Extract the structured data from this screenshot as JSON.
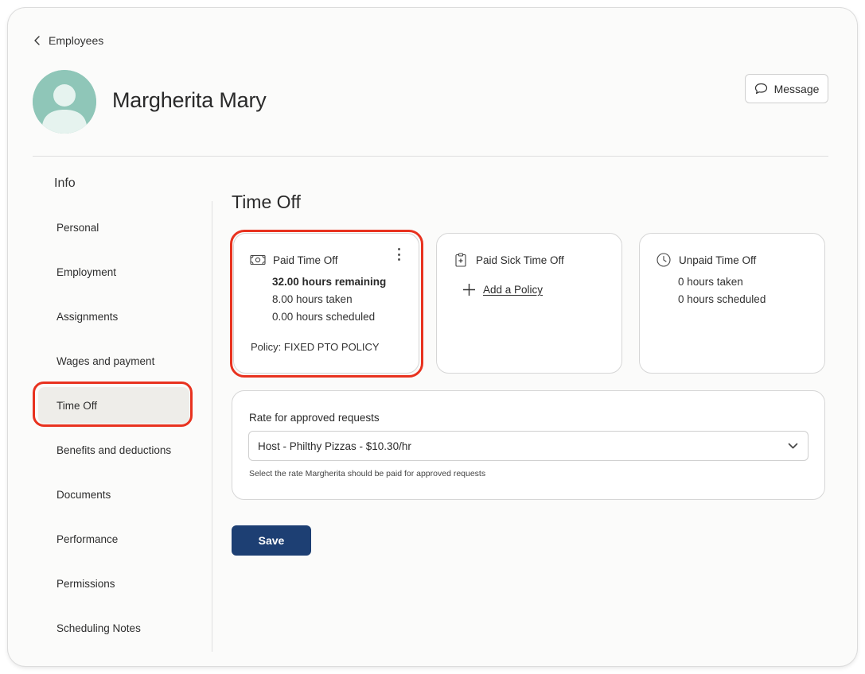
{
  "breadcrumb": {
    "back_label": "Employees"
  },
  "employee": {
    "name": "Margherita Mary"
  },
  "header": {
    "message_label": "Message"
  },
  "sidebar": {
    "title": "Info",
    "active_item": "Time Off",
    "items": [
      {
        "label": "Personal"
      },
      {
        "label": "Employment"
      },
      {
        "label": "Assignments"
      },
      {
        "label": "Wages and payment"
      },
      {
        "label": "Time Off"
      },
      {
        "label": "Benefits and deductions"
      },
      {
        "label": "Documents"
      },
      {
        "label": "Performance"
      },
      {
        "label": "Permissions"
      },
      {
        "label": "Scheduling Notes"
      }
    ]
  },
  "main": {
    "title": "Time Off",
    "cards": {
      "paid": {
        "title": "Paid Time Off",
        "remaining": "32.00 hours remaining",
        "taken": "8.00 hours taken",
        "scheduled": "0.00 hours scheduled",
        "policy": "Policy: FIXED PTO POLICY",
        "icon": "cash-icon"
      },
      "sick": {
        "title": "Paid Sick Time Off",
        "add_policy_label": "Add a Policy",
        "icon": "medical-clipboard-icon"
      },
      "unpaid": {
        "title": "Unpaid Time Off",
        "taken": "0 hours taken",
        "scheduled": "0 hours scheduled",
        "icon": "clock-icon"
      }
    },
    "rate": {
      "label": "Rate for approved requests",
      "selected_value": "Host - Philthy Pizzas - $10.30/hr",
      "helper_text": "Select the rate Margherita should be paid for approved requests"
    },
    "save_label": "Save"
  },
  "colors": {
    "primary_button": "#1d3f73",
    "highlight": "#e8321f",
    "avatar_bg": "#8fc6b8",
    "active_item_bg": "#eeede9"
  }
}
